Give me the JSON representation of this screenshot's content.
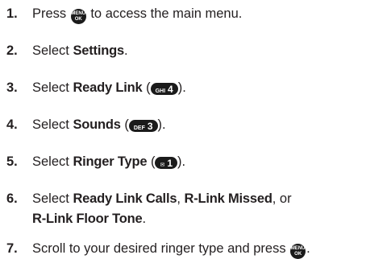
{
  "steps": [
    {
      "number": "1.",
      "before": "Press ",
      "icon": {
        "name": "menu-ok-key",
        "top": "MENU",
        "bottom": "OK"
      },
      "after": " to access the main menu."
    },
    {
      "number": "2.",
      "before": "Select ",
      "bold": "Settings",
      "after": "."
    },
    {
      "number": "3.",
      "before": "Select ",
      "bold": "Ready Link",
      "paren_open": " (",
      "key": {
        "name": "ghi4-key",
        "letters": "GHI",
        "digit": "4"
      },
      "paren_close": ")."
    },
    {
      "number": "4.",
      "before": "Select ",
      "bold": "Sounds",
      "paren_open": " (",
      "key": {
        "name": "def3-key",
        "letters": "DEF",
        "digit": "3"
      },
      "paren_close": ")."
    },
    {
      "number": "5.",
      "before": "Select ",
      "bold": "Ringer Type",
      "paren_open": " (",
      "key": {
        "name": "voicemail1-key",
        "letters": "✉",
        "digit": "1"
      },
      "paren_close": ")."
    },
    {
      "number": "6.",
      "before": "Select ",
      "bold1": "Ready Link Calls",
      "sep1": ", ",
      "bold2": "R-Link Missed",
      "sep2": ", or",
      "bold3": "R-Link Floor Tone",
      "after": "."
    },
    {
      "number": "7.",
      "before": "Scroll to your desired ringer type and press ",
      "icon": {
        "name": "menu-ok-key",
        "top": "MENU",
        "bottom": "OK"
      },
      "after": "."
    }
  ]
}
